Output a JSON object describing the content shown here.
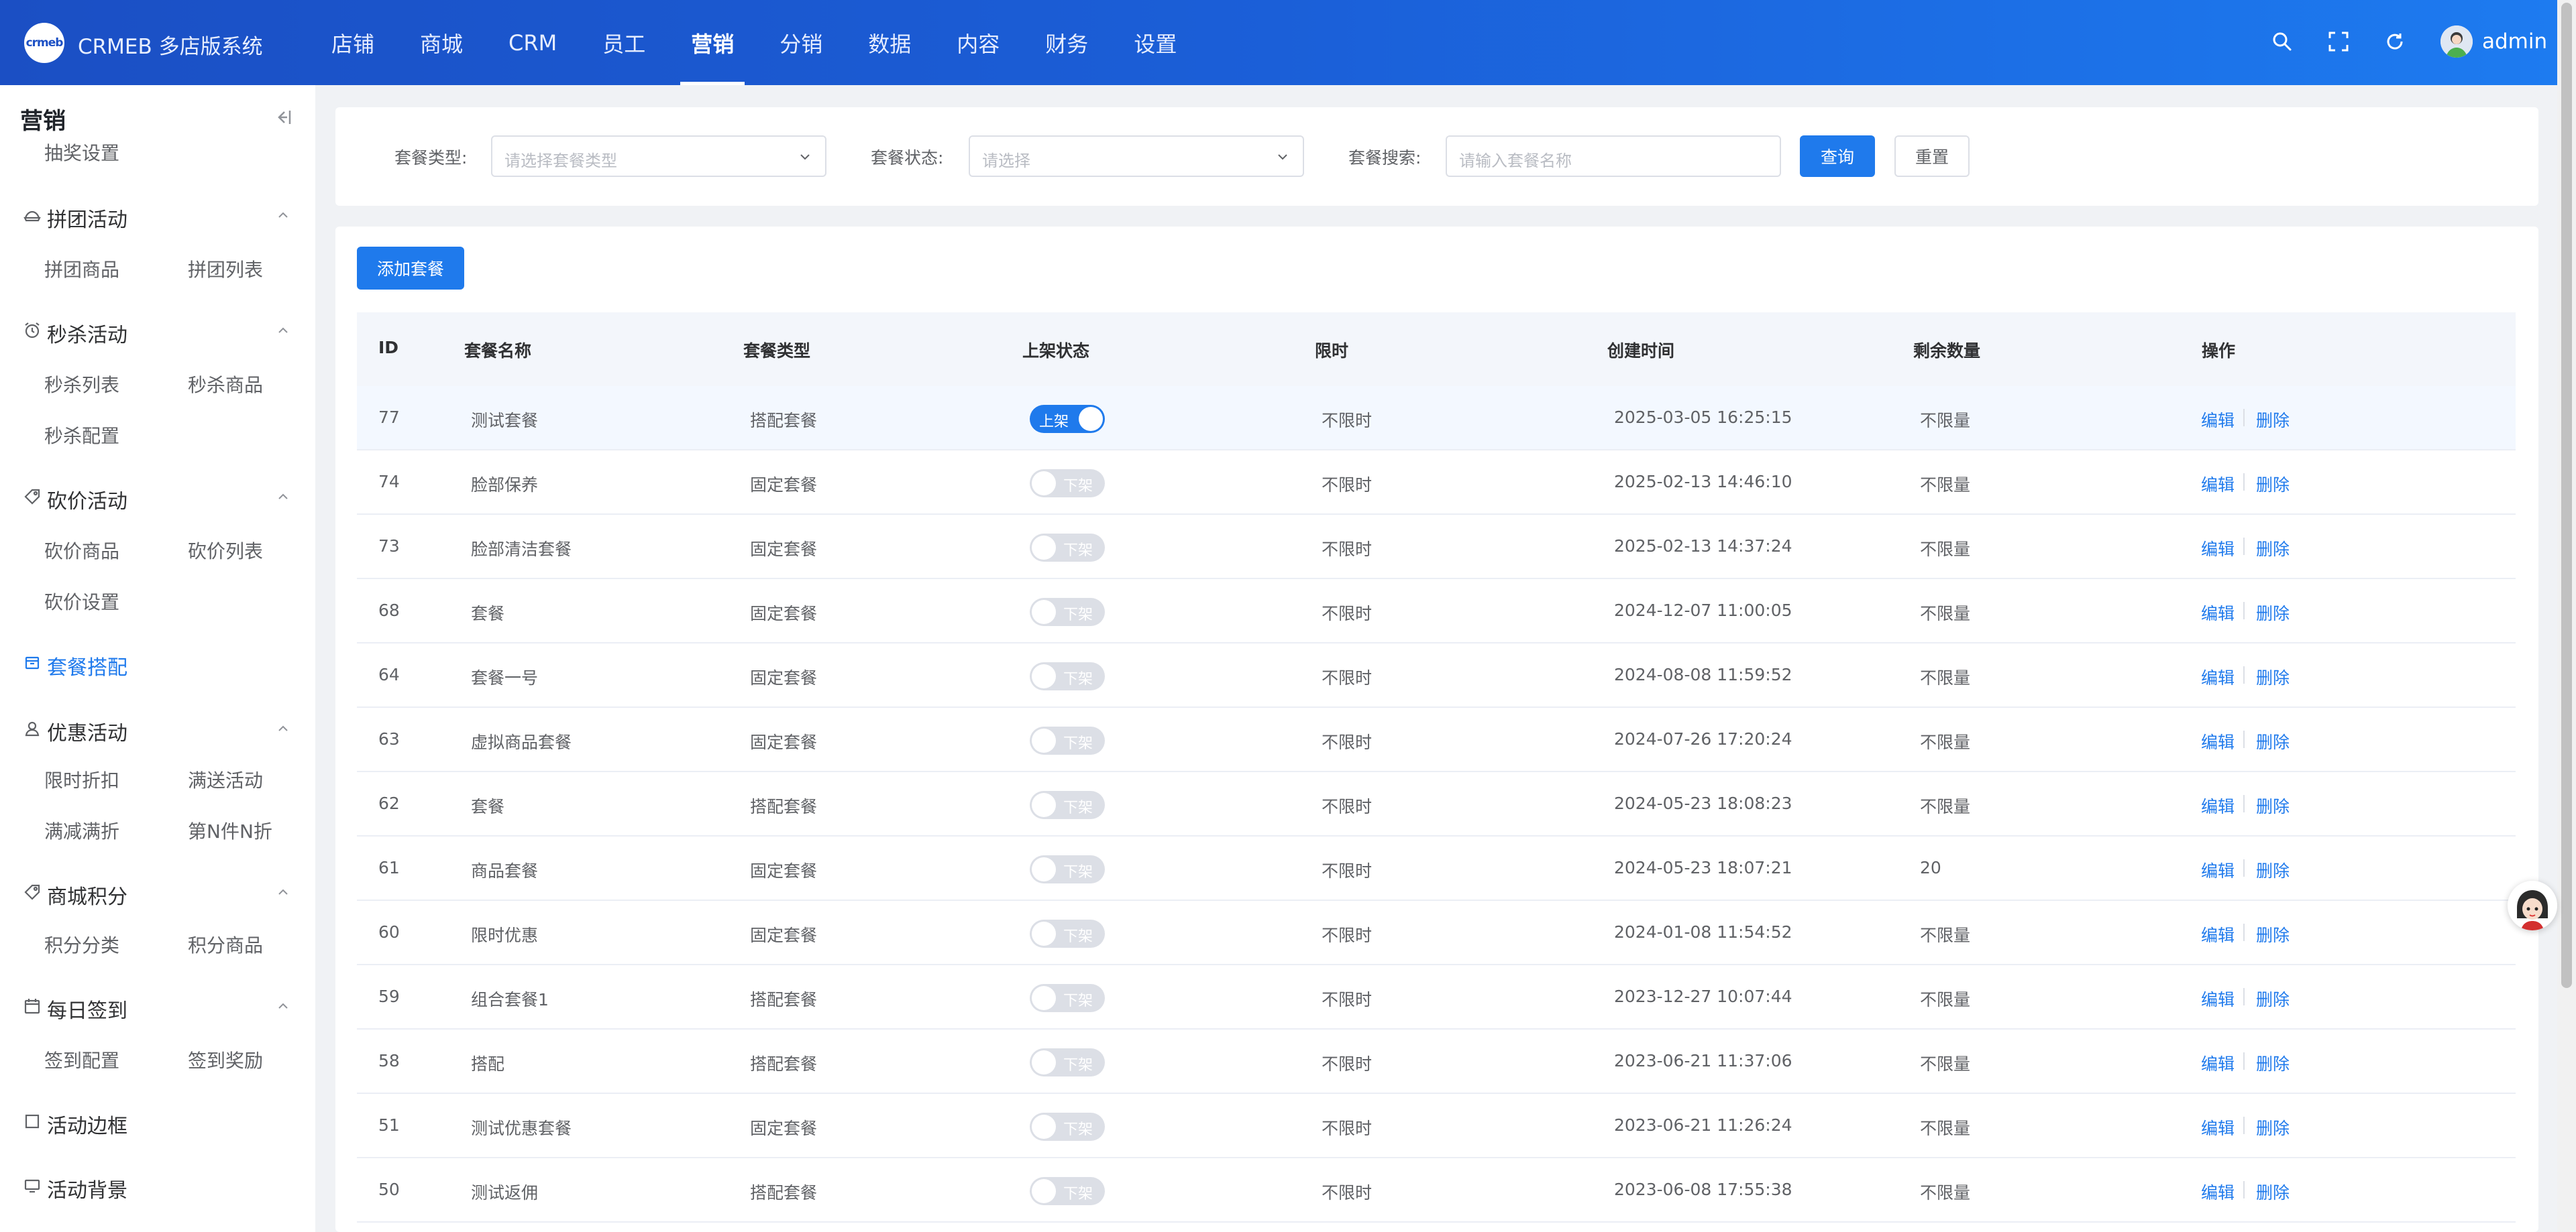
{
  "app": {
    "logo_text": "crmeb",
    "title": "CRMEB 多店版系统",
    "nav": [
      "店铺",
      "商城",
      "CRM",
      "员工",
      "营销",
      "分销",
      "数据",
      "内容",
      "财务",
      "设置"
    ],
    "active_nav": "营销",
    "user": "admin"
  },
  "sidebar": {
    "title": "营销",
    "partial_item": "抽奖设置",
    "groups": [
      {
        "label": "拼团活动",
        "icon": "group-buy-icon",
        "items": [
          "拼团商品",
          "拼团列表"
        ]
      },
      {
        "label": "秒杀活动",
        "icon": "alarm-clock-icon",
        "items": [
          "秒杀列表",
          "秒杀商品",
          "秒杀配置"
        ]
      },
      {
        "label": "砍价活动",
        "icon": "tag-icon",
        "items": [
          "砍价商品",
          "砍价列表",
          "砍价设置"
        ]
      },
      {
        "label": "套餐搭配",
        "icon": "package-icon",
        "items": []
      },
      {
        "label": "优惠活动",
        "icon": "user-icon",
        "items": [
          "限时折扣",
          "满送活动",
          "满减满折",
          "第N件N折"
        ]
      },
      {
        "label": "商城积分",
        "icon": "tag-icon",
        "items": [
          "积分分类",
          "积分商品"
        ]
      },
      {
        "label": "每日签到",
        "icon": "calendar-icon",
        "items": [
          "签到配置",
          "签到奖励"
        ]
      },
      {
        "label": "活动边框",
        "icon": "frame-icon",
        "items": []
      },
      {
        "label": "活动背景",
        "icon": "monitor-icon",
        "items": []
      }
    ]
  },
  "filters": {
    "type_label": "套餐类型:",
    "type_placeholder": "请选择套餐类型",
    "status_label": "套餐状态:",
    "status_placeholder": "请选择",
    "search_label": "套餐搜索:",
    "search_placeholder": "请输入套餐名称",
    "search_button": "查询",
    "reset_button": "重置"
  },
  "table": {
    "add_button": "添加套餐",
    "columns": [
      "ID",
      "套餐名称",
      "套餐类型",
      "上架状态",
      "限时",
      "创建时间",
      "剩余数量",
      "操作"
    ],
    "on_text": "上架",
    "off_text": "下架",
    "edit_text": "编辑",
    "delete_text": "删除",
    "rows": [
      {
        "id": "77",
        "name": "测试套餐",
        "type": "搭配套餐",
        "on": true,
        "limit": "不限时",
        "created": "2025-03-05 16:25:15",
        "stock": "不限量"
      },
      {
        "id": "74",
        "name": "脸部保养",
        "type": "固定套餐",
        "on": false,
        "limit": "不限时",
        "created": "2025-02-13 14:46:10",
        "stock": "不限量"
      },
      {
        "id": "73",
        "name": "脸部清洁套餐",
        "type": "固定套餐",
        "on": false,
        "limit": "不限时",
        "created": "2025-02-13 14:37:24",
        "stock": "不限量"
      },
      {
        "id": "68",
        "name": "套餐",
        "type": "固定套餐",
        "on": false,
        "limit": "不限时",
        "created": "2024-12-07 11:00:05",
        "stock": "不限量"
      },
      {
        "id": "64",
        "name": "套餐一号",
        "type": "固定套餐",
        "on": false,
        "limit": "不限时",
        "created": "2024-08-08 11:59:52",
        "stock": "不限量"
      },
      {
        "id": "63",
        "name": "虚拟商品套餐",
        "type": "固定套餐",
        "on": false,
        "limit": "不限时",
        "created": "2024-07-26 17:20:24",
        "stock": "不限量"
      },
      {
        "id": "62",
        "name": "套餐",
        "type": "搭配套餐",
        "on": false,
        "limit": "不限时",
        "created": "2024-05-23 18:08:23",
        "stock": "不限量"
      },
      {
        "id": "61",
        "name": "商品套餐",
        "type": "固定套餐",
        "on": false,
        "limit": "不限时",
        "created": "2024-05-23 18:07:21",
        "stock": "20"
      },
      {
        "id": "60",
        "name": "限时优惠",
        "type": "固定套餐",
        "on": false,
        "limit": "不限时",
        "created": "2024-01-08 11:54:52",
        "stock": "不限量"
      },
      {
        "id": "59",
        "name": "组合套餐1",
        "type": "搭配套餐",
        "on": false,
        "limit": "不限时",
        "created": "2023-12-27 10:07:44",
        "stock": "不限量"
      },
      {
        "id": "58",
        "name": "搭配",
        "type": "搭配套餐",
        "on": false,
        "limit": "不限时",
        "created": "2023-06-21 11:37:06",
        "stock": "不限量"
      },
      {
        "id": "51",
        "name": "测试优惠套餐",
        "type": "固定套餐",
        "on": false,
        "limit": "不限时",
        "created": "2023-06-21 11:26:24",
        "stock": "不限量"
      },
      {
        "id": "50",
        "name": "测试返佣",
        "type": "搭配套餐",
        "on": false,
        "limit": "不限时",
        "created": "2023-06-08 17:55:38",
        "stock": "不限量"
      }
    ]
  },
  "colors": {
    "primary": "#1f7aec",
    "header_start": "#1b4fc4",
    "header_end": "#1d7bf0"
  }
}
